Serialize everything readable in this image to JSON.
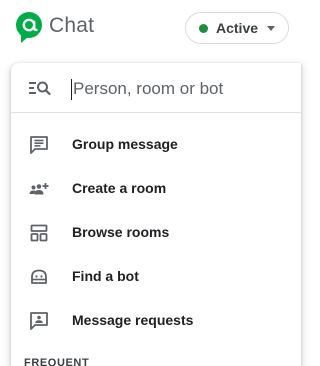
{
  "app": {
    "title": "Chat"
  },
  "status": {
    "label": "Active",
    "color": "#1e8e3e"
  },
  "search": {
    "placeholder": "Person, room or bot"
  },
  "menu": {
    "items": [
      {
        "label": "Group message",
        "icon": "group-message-icon"
      },
      {
        "label": "Create a room",
        "icon": "create-room-icon"
      },
      {
        "label": "Browse rooms",
        "icon": "browse-rooms-icon"
      },
      {
        "label": "Find a bot",
        "icon": "bot-icon"
      },
      {
        "label": "Message requests",
        "icon": "message-requests-icon"
      }
    ]
  },
  "sections": {
    "frequent": "FREQUENT"
  },
  "colors": {
    "brand_green": "#00ac47",
    "icon_gray": "#5f6368"
  }
}
